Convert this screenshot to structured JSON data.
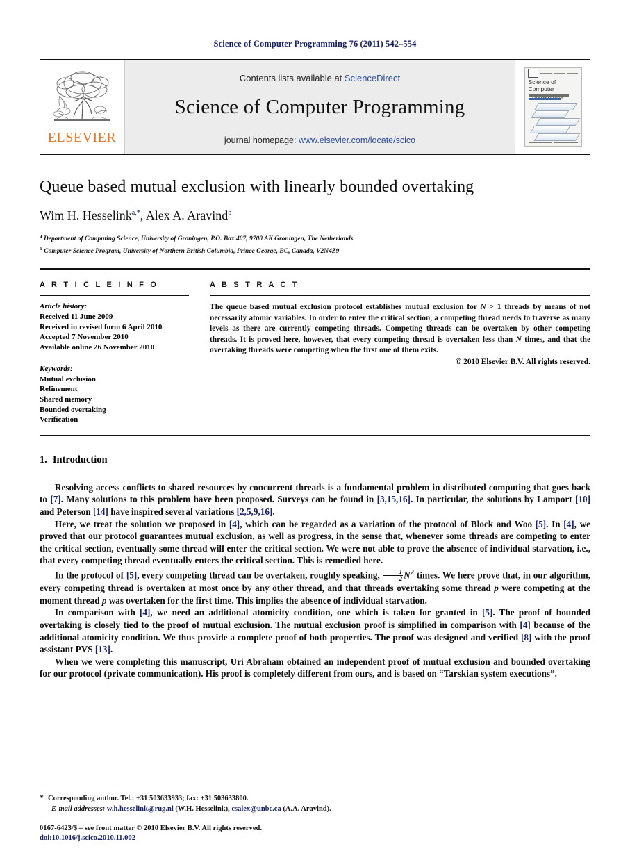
{
  "running_head": "Science of Computer Programming 76 (2011) 542–554",
  "masthead": {
    "contents_prefix": "Contents lists available at ",
    "contents_link": "ScienceDirect",
    "journal_name": "Science of Computer Programming",
    "homepage_prefix": "journal homepage: ",
    "homepage_link": "www.elsevier.com/locate/scico",
    "publisher": "ELSEVIER",
    "cover": {
      "title": "Science of Computer Programming"
    }
  },
  "article": {
    "title": "Queue based mutual exclusion with linearly bounded overtaking",
    "authors": [
      {
        "name": "Wim H. Hesselink",
        "marks": "a,*"
      },
      {
        "name": "Alex A. Aravind",
        "marks": "b"
      }
    ],
    "affiliations": [
      {
        "mark": "a",
        "text": "Department of Computing Science, University of Groningen, P.O. Box 407, 9700 AK Groningen, The Netherlands"
      },
      {
        "mark": "b",
        "text": "Computer Science Program, University of Northern British Columbia, Prince George, BC, Canada, V2N4Z9"
      }
    ]
  },
  "info": {
    "heading": "A R T I C L E    I N F O",
    "history_label": "Article history:",
    "history": [
      "Received 11 June 2009",
      "Received in revised form 6 April 2010",
      "Accepted 7 November 2010",
      "Available online 26 November 2010"
    ],
    "keywords_label": "Keywords:",
    "keywords": [
      "Mutual exclusion",
      "Refinement",
      "Shared memory",
      "Bounded overtaking",
      "Verification"
    ]
  },
  "abstract": {
    "heading": "A B S T R A C T",
    "p1_a": "The queue based mutual exclusion protocol establishes mutual exclusion for ",
    "p1_N1": "N",
    "p1_b": " > 1 threads by means of not necessarily atomic variables. In order to enter the critical section, a competing thread needs to traverse as many levels as there are currently competing threads. Competing threads can be overtaken by other competing threads. It is proved here, however, that every competing thread is overtaken less than ",
    "p1_N2": "N",
    "p1_c": " times, and that the overtaking threads were competing when the first one of them exits.",
    "copyright": "© 2010 Elsevier B.V. All rights reserved."
  },
  "section": {
    "number": "1.",
    "title": "Introduction"
  },
  "paragraphs": {
    "p1": {
      "s1": "Resolving access conflicts to shared resources by concurrent threads is a fundamental problem in distributed computing that goes back to ",
      "c1": "[7]",
      "s2": ". Many solutions to this problem have been proposed. Surveys can be found in ",
      "c2": "[3,15,16]",
      "s3": ". In particular, the solutions by Lamport ",
      "c3": "[10]",
      "s4": " and Peterson ",
      "c4": "[14]",
      "s5": " have inspired several variations ",
      "c5": "[2,5,9,16]",
      "s6": "."
    },
    "p2": {
      "s1": "Here, we treat the solution we proposed in ",
      "c1": "[4]",
      "s2": ", which can be regarded as a variation of the protocol of Block and Woo ",
      "c2": "[5]",
      "s3": ". In ",
      "c3": "[4]",
      "s4": ", we proved that our protocol guarantees mutual exclusion, as well as progress, in the sense that, whenever some threads are competing to enter the critical section, eventually some thread will enter the critical section. We were not able to prove the absence of individual starvation, i.e., that every competing thread eventually enters the critical section. This is remedied here."
    },
    "p3": {
      "s1": "In the protocol of ",
      "c1": "[5]",
      "s2": ", every competing thread can be overtaken, roughly speaking, ",
      "frac_num": "1",
      "frac_den": "2",
      "frac_var": "N",
      "frac_exp": "2",
      "s3": " times. We here prove that, in our algorithm, every competing thread is overtaken at most once by any other thread, and that threads overtaking some thread ",
      "var1": "p",
      "s4": " were competing at the moment thread ",
      "var2": "p",
      "s5": " was overtaken for the first time. This implies the absence of individual starvation."
    },
    "p4": {
      "s1": "In comparison with ",
      "c1": "[4]",
      "s2": ", we need an additional atomicity condition, one which is taken for granted in ",
      "c2": "[5]",
      "s3": ". The proof of bounded overtaking is closely tied to the proof of mutual exclusion. The mutual exclusion proof is simplified in comparison with ",
      "c3": "[4]",
      "s4": " because of the additional atomicity condition. We thus provide a complete proof of both properties. The proof was designed and verified ",
      "c4": "[8]",
      "s5": " with the proof assistant PVS ",
      "c5": "[13]",
      "s6": "."
    },
    "p5": {
      "s1": "When we were completing this manuscript, Uri Abraham obtained an independent proof of mutual exclusion and bounded overtaking for our protocol (private communication). His proof is completely different from ours, and is based on “Tarskian system executions”."
    }
  },
  "footnote": {
    "star": "*",
    "corresponding": "Corresponding author. Tel.: +31 503633933; fax: +31 503633800.",
    "email_label": "E-mail addresses:",
    "email1": "w.h.hesselink@rug.nl",
    "email1_owner": "(W.H. Hesselink)",
    "email_sep": ",",
    "email2": "csalex@unbc.ca",
    "email2_owner": "(A.A. Aravind)",
    "end": "."
  },
  "imprint": {
    "line1": "0167-6423/$ – see front matter © 2010 Elsevier B.V. All rights reserved.",
    "doi": "doi:10.1016/j.scico.2010.11.002"
  },
  "colors": {
    "link": "#2a4b9b",
    "citation": "#16216b",
    "elsevier_orange": "#E87722",
    "masthead_bg": "#ececec"
  }
}
